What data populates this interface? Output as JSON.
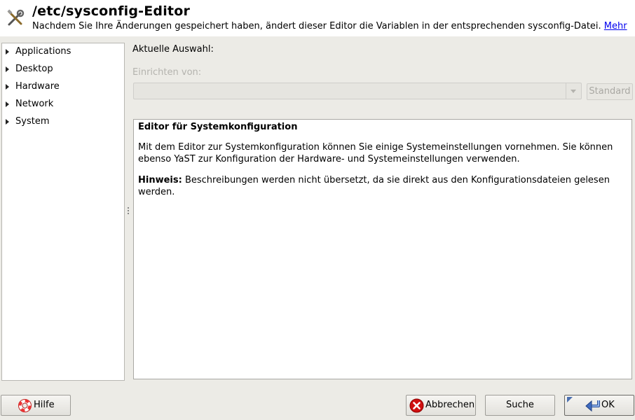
{
  "header": {
    "title": "/etc/sysconfig-Editor",
    "subtitle": "Nachdem Sie Ihre Änderungen gespeichert haben, ändert dieser Editor die Variablen in der entsprechenden sysconfig-Datei.",
    "more_link": "Mehr",
    "icon": "tools-icon"
  },
  "tree": {
    "items": [
      {
        "label": "Applications"
      },
      {
        "label": "Desktop"
      },
      {
        "label": "Hardware"
      },
      {
        "label": "Network"
      },
      {
        "label": "System"
      }
    ]
  },
  "main": {
    "current_selection_label": "Aktuelle Auswahl:",
    "setup_from_label": "Einrichten von:",
    "setup_value": "",
    "standard_button": "Standard",
    "help": {
      "title": "Editor für Systemkonfiguration",
      "paragraph1": "Mit dem Editor zur Systemkonfiguration können Sie einige Systemeinstellungen vornehmen. Sie können ebenso YaST zur Konfiguration der Hardware- und Systemeinstellungen verwenden.",
      "note_label": "Hinweis:",
      "note_text": " Beschreibungen werden nicht übersetzt, da sie direkt aus den Konfigurationsdateien gelesen werden."
    }
  },
  "buttons": {
    "help": "Hilfe",
    "abort": "Abbrechen",
    "search": "Suche",
    "ok": "OK"
  }
}
